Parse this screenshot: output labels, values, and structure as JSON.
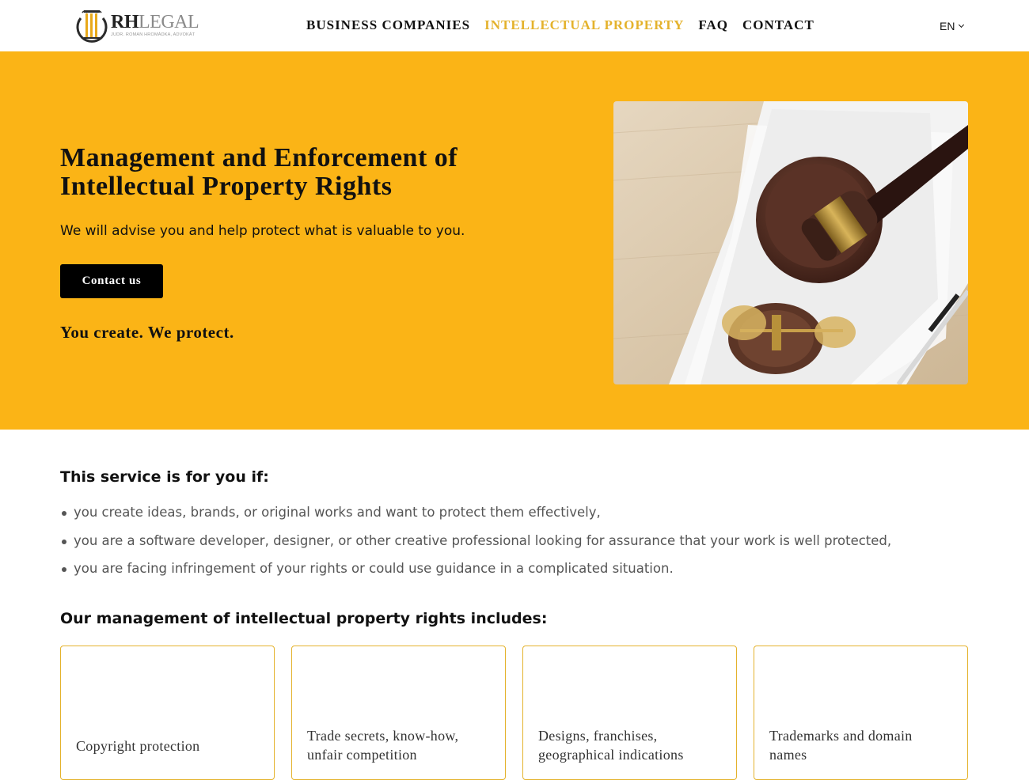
{
  "header": {
    "logo": {
      "main_bold": "RH",
      "main_light": "LEGAL",
      "sub": "JUDR. ROMAN HROMÁDKA, ADVOKÁT"
    },
    "nav": [
      {
        "label": "BUSINESS COMPANIES",
        "active": false
      },
      {
        "label": "INTELLECTUAL PROPERTY",
        "active": true
      },
      {
        "label": "FAQ",
        "active": false
      },
      {
        "label": "CONTACT",
        "active": false
      }
    ],
    "language": "EN"
  },
  "hero": {
    "title": "Management and Enforcement of Intellectual Property Rights",
    "subtitle": "We will advise you and help protect what is valuable to you.",
    "button_label": "Contact us",
    "tagline": "You create. We protect.",
    "image_icon": "gavel-and-scales-photo",
    "background_color": "#fbb416"
  },
  "service": {
    "title": "This service is for you if:",
    "items": [
      "you create ideas, brands, or original works and want to protect them effectively,",
      "you are a software developer, designer, or other creative professional looking for assurance that your work is well protected,",
      "you are facing infringement of your rights or could use guidance in a complicated situation."
    ]
  },
  "management": {
    "title": "Our management of intellectual property rights includes:",
    "cards": [
      {
        "line1": "Copyright protection",
        "line2": ""
      },
      {
        "line1": "Trade secrets, know-how,",
        "line2": "unfair competition"
      },
      {
        "line1": "Designs, franchises,",
        "line2": "geographical indications"
      },
      {
        "line1": "Trademarks and domain",
        "line2": "names"
      }
    ]
  },
  "colors": {
    "accent": "#e4b22c",
    "hero_bg": "#fbb416",
    "text": "#111111"
  }
}
